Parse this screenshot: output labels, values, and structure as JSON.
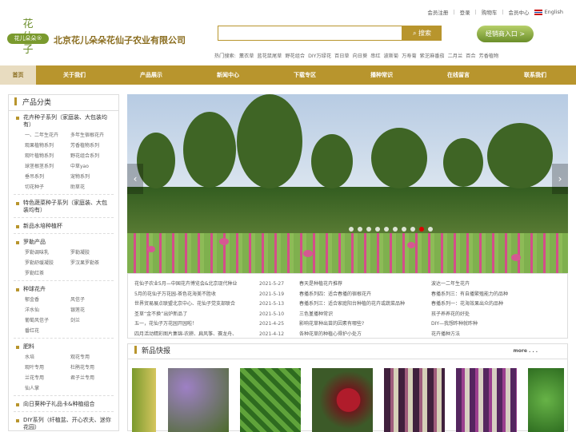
{
  "header": {
    "logo_text": "花仙子",
    "logo_pill": "花儿朵朵®",
    "company": "北京花儿朵朵花仙子农业有限公司",
    "links": [
      "会员注册",
      "登录",
      "购物车",
      "会员中心",
      "English"
    ],
    "search_placeholder": "",
    "search_label": "搜索",
    "dealer_label": "经销商入口 >",
    "hot_label": "热门搜索:",
    "hot_keywords": [
      "薰衣草",
      "蓝花鼠尾草",
      "野花组合",
      "DIY万绿花",
      "百日草",
      "向日葵",
      "串红",
      "波斯菊",
      "万寿菊",
      "紫芝麻番茄",
      "二月兰",
      "百合",
      "芳香植物"
    ]
  },
  "nav": [
    "首页",
    "关于我们",
    "产品展示",
    "新闻中心",
    "下载专区",
    "播种常识",
    "在线留言",
    "联系我们"
  ],
  "sidebar": {
    "title": "产品分类",
    "cats": [
      {
        "name": "花卉种子系列（家庭装、大包装均有）",
        "subs": [
          "一、二年生花卉",
          "多年生宿根花卉",
          "观果植物系列",
          "芳香植物系列",
          "观叶植物系列",
          "野花组合系列",
          "球茎根茎系列",
          "中草yao",
          "垂吊系列",
          "宠物系列",
          "切花种子",
          "助草花"
        ]
      },
      {
        "name": "特色蔬菜种子系列（家庭装、大包装均有）",
        "subs": []
      },
      {
        "name": "新品水培种植杯",
        "subs": []
      },
      {
        "name": "罗勒产品",
        "subs": [
          "罗勒调味乳",
          "罗勒凝胶",
          "罗勒舒缓凝胶",
          "罗汉果罗勒茶",
          "罗勒红茶"
        ]
      },
      {
        "name": "种球花卉",
        "subs": [
          "郁金香",
          "风信子",
          "洋水仙",
          "银莲花",
          "葡萄风信子",
          "剑兰",
          "番红花"
        ]
      },
      {
        "name": "肥料",
        "subs": [
          "水培",
          "观花专用",
          "观叶专用",
          "杜鹃花专用",
          "兰花专用",
          "君子兰专用",
          "仙人掌"
        ]
      },
      {
        "name": "向日葵种子礼品卡&种植组合",
        "subs": []
      },
      {
        "name": "DIY系列（纤植盆、开心农夫、迷你花园）",
        "subs": []
      },
      {
        "name": "栽培介质",
        "subs": []
      }
    ]
  },
  "banner": {
    "dots": 10,
    "active": 8
  },
  "news": {
    "left": [
      [
        "花仙子农业5月—中国花卉博览会&北京现代种业",
        "2021-5-27"
      ],
      [
        "5月的花仙子万花园-茶色花海美不胜收",
        "2021-5-19"
      ],
      [
        "世界贸易展点联盟北京中心、花仙子党支部联合",
        "2021-5-13"
      ],
      [
        "圣草“金不换”出炉新品了",
        "2021-5-10"
      ],
      [
        "五一，花仙子万花园开园啦！",
        "2021-4-25"
      ],
      [
        "四月活动精彩图片集锦-农耕、扁风筝、赛龙舟、",
        "2021-4-12"
      ]
    ],
    "mid": [
      "春天是种植花卉推荐",
      "春播系列四：适合春播的宿根花卉",
      "春播系列三：适合家庭阳台种植的花卉或蔬菜品种",
      "三色堇播种常识",
      "影响花草种出苗的因素有哪些?",
      "各种花草的种植心得护小处方"
    ],
    "right": [
      "波达一二年生花卉",
      "春播系列三：有自播繁殖能力的品种",
      "春播系列一：花海效果出众的品种",
      "孩子养养花的好处",
      "DIY—我想昨种就昨种",
      "花卉播种方法"
    ]
  },
  "quick": {
    "title": "新品快报",
    "more": "more . . ."
  },
  "colors": {
    "brand": "#b8952d",
    "green": "#6b8e2a"
  }
}
